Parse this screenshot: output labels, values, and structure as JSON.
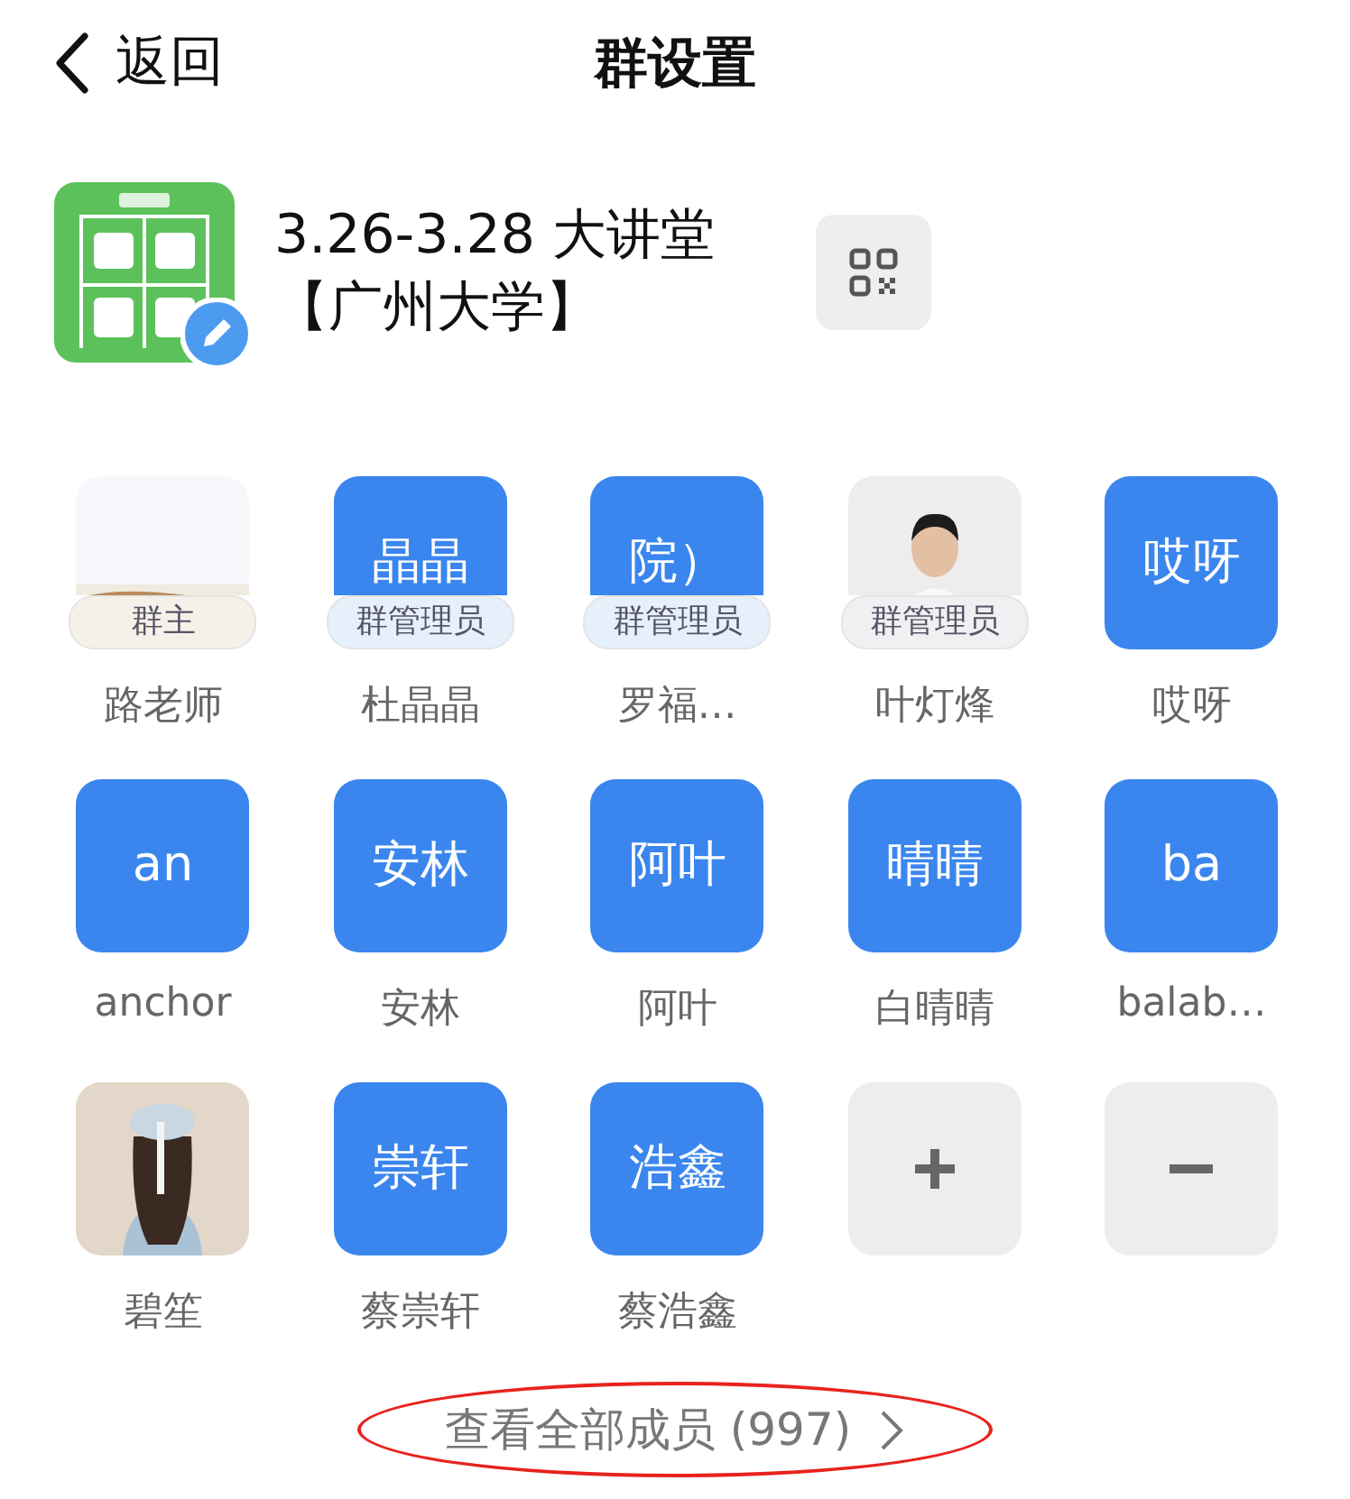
{
  "nav": {
    "back": "返回",
    "title": "群设置"
  },
  "group": {
    "name": "3.26-3.28 大讲堂【广州大学】",
    "editable": true
  },
  "members": [
    {
      "name": "路老师",
      "role": {
        "text": "群主",
        "color": "#f6f1e8"
      }
    },
    {
      "kind": "text",
      "avatar_text": "晶晶",
      "name": "杜晶晶",
      "role": {
        "text": "群管理员",
        "color": "#e6f0fb"
      }
    },
    {
      "kind": "text",
      "avatar_text": "院）",
      "name": "罗福…",
      "role": {
        "text": "群管理员",
        "color": "#e6f0fb"
      }
    },
    {
      "name": "叶灯烽",
      "role": {
        "text": "群管理员",
        "color": "#f0f0f2"
      }
    },
    {
      "kind": "text",
      "avatar_text": "哎呀",
      "name": "哎呀"
    },
    {
      "kind": "text",
      "avatar_text": "an",
      "name": "anchor"
    },
    {
      "kind": "text",
      "avatar_text": "安林",
      "name": "安林"
    },
    {
      "kind": "text",
      "avatar_text": "阿叶",
      "name": "阿叶"
    },
    {
      "kind": "text",
      "avatar_text": "晴晴",
      "name": "白晴晴"
    },
    {
      "kind": "text",
      "avatar_text": "ba",
      "name": "balab…"
    },
    {
      "name": "碧笙"
    },
    {
      "kind": "text",
      "avatar_text": "崇轩",
      "name": "蔡崇轩"
    },
    {
      "kind": "text",
      "avatar_text": "浩鑫",
      "name": "蔡浩鑫"
    },
    {
      "kind": "add"
    },
    {
      "kind": "remove"
    }
  ],
  "view_all": {
    "label": "查看全部成员 (997)",
    "circled": true
  }
}
